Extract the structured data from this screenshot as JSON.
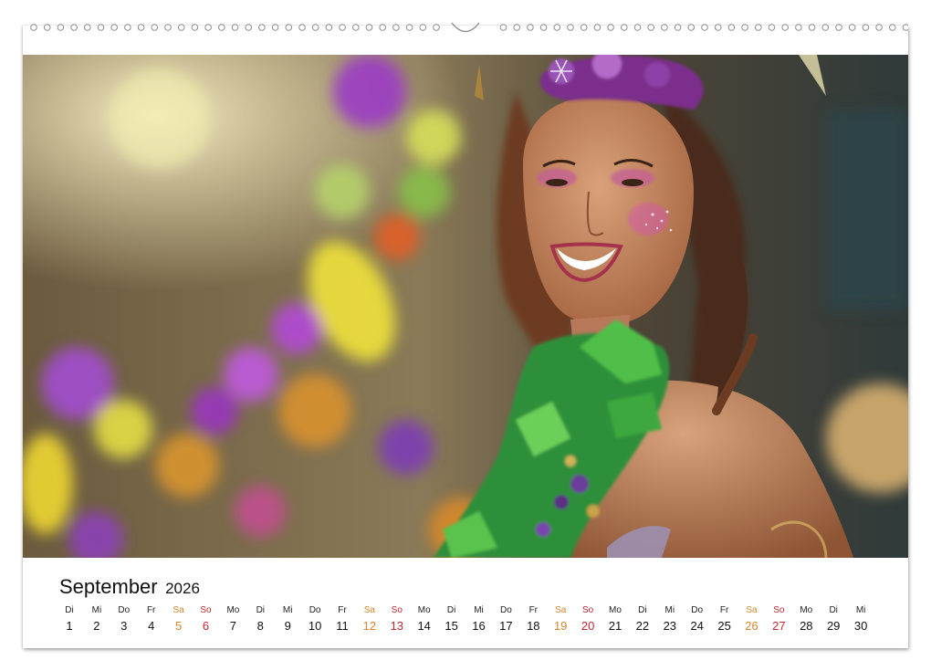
{
  "calendar": {
    "month": "September",
    "year": "2026",
    "days": [
      {
        "wd": "Di",
        "d": "1"
      },
      {
        "wd": "Mi",
        "d": "2"
      },
      {
        "wd": "Do",
        "d": "3"
      },
      {
        "wd": "Fr",
        "d": "4"
      },
      {
        "wd": "Sa",
        "d": "5"
      },
      {
        "wd": "So",
        "d": "6"
      },
      {
        "wd": "Mo",
        "d": "7"
      },
      {
        "wd": "Di",
        "d": "8"
      },
      {
        "wd": "Mi",
        "d": "9"
      },
      {
        "wd": "Do",
        "d": "10"
      },
      {
        "wd": "Fr",
        "d": "11"
      },
      {
        "wd": "Sa",
        "d": "12"
      },
      {
        "wd": "So",
        "d": "13"
      },
      {
        "wd": "Mo",
        "d": "14"
      },
      {
        "wd": "Di",
        "d": "15"
      },
      {
        "wd": "Mi",
        "d": "16"
      },
      {
        "wd": "Do",
        "d": "17"
      },
      {
        "wd": "Fr",
        "d": "18"
      },
      {
        "wd": "Sa",
        "d": "19"
      },
      {
        "wd": "So",
        "d": "20"
      },
      {
        "wd": "Mo",
        "d": "21"
      },
      {
        "wd": "Di",
        "d": "22"
      },
      {
        "wd": "Mi",
        "d": "23"
      },
      {
        "wd": "Do",
        "d": "24"
      },
      {
        "wd": "Fr",
        "d": "25"
      },
      {
        "wd": "Sa",
        "d": "26"
      },
      {
        "wd": "So",
        "d": "27"
      },
      {
        "wd": "Mo",
        "d": "28"
      },
      {
        "wd": "Di",
        "d": "29"
      },
      {
        "wd": "Mi",
        "d": "30"
      }
    ]
  },
  "colors": {
    "saturday": "#d9832b",
    "sunday": "#c0282f",
    "text": "#111111"
  }
}
